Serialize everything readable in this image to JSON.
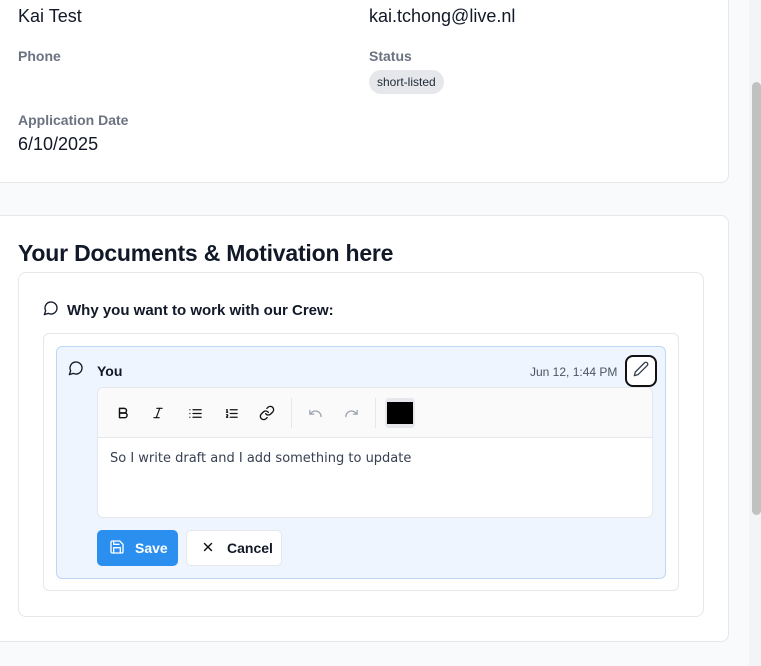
{
  "profile": {
    "name_value": "Kai Test",
    "email_value": "kai.tchong@live.nl",
    "phone_label": "Phone",
    "phone_value": "",
    "status_label": "Status",
    "status_badge": "short-listed",
    "application_date_label": "Application Date",
    "application_date_value": "6/10/2025"
  },
  "documents": {
    "section_title": "Your Documents & Motivation here",
    "question_label": "Why you want to work with our Crew:",
    "comment": {
      "author": "You",
      "date": "Jun 12, 1:44 PM",
      "text": "So I write draft and I add something to update"
    },
    "toolbar": {
      "icons": [
        "bold-icon",
        "italic-icon",
        "bullet-list-icon",
        "numbered-list-icon",
        "link-icon",
        "undo-icon",
        "redo-icon"
      ],
      "text_color": "#000000"
    },
    "save_label": "Save",
    "cancel_label": "Cancel"
  },
  "colors": {
    "primary": "#2b8ff0",
    "comment_bg": "#eef5fe",
    "badge_bg": "#e5e7eb"
  }
}
